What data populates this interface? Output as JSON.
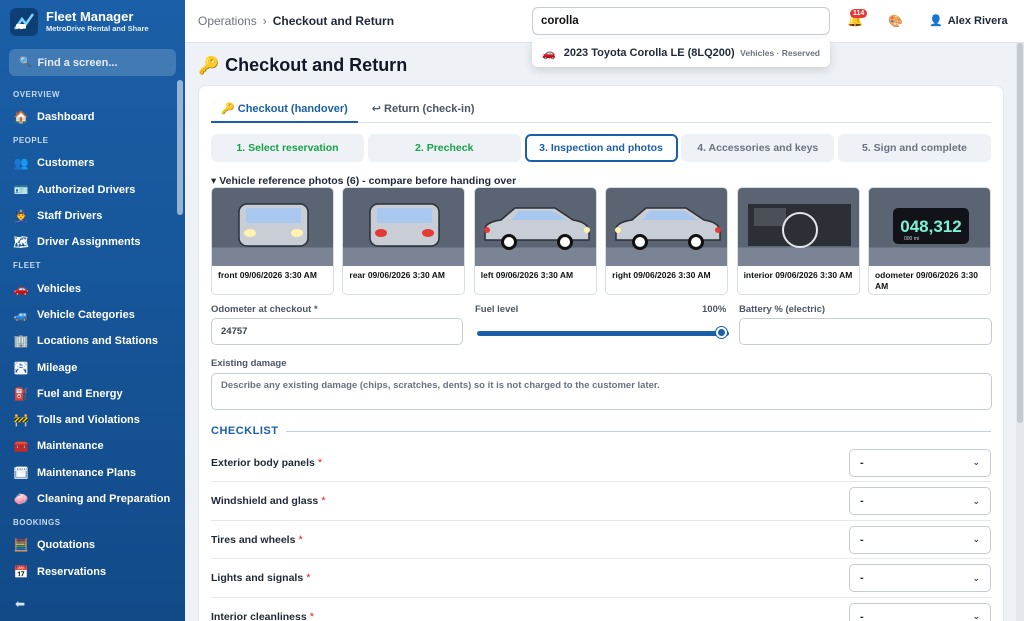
{
  "brand": {
    "title": "Fleet Manager",
    "subtitle": "MetroDrive Rental and Share"
  },
  "sidebar": {
    "find_placeholder": "Find a screen...",
    "sections": [
      {
        "label": "OVERVIEW",
        "items": [
          {
            "label": "Dashboard",
            "icon": "🏠"
          }
        ]
      },
      {
        "label": "PEOPLE",
        "items": [
          {
            "label": "Customers",
            "icon": "👥"
          },
          {
            "label": "Authorized Drivers",
            "icon": "🪪"
          },
          {
            "label": "Staff Drivers",
            "icon": "👮"
          },
          {
            "label": "Driver Assignments",
            "icon": "🗺"
          }
        ]
      },
      {
        "label": "FLEET",
        "items": [
          {
            "label": "Vehicles",
            "icon": "🚗"
          },
          {
            "label": "Vehicle Categories",
            "icon": "🚙"
          },
          {
            "label": "Locations and Stations",
            "icon": "🏢"
          },
          {
            "label": "Mileage",
            "icon": "🛣"
          },
          {
            "label": "Fuel and Energy",
            "icon": "⛽"
          },
          {
            "label": "Tolls and Violations",
            "icon": "🚧"
          },
          {
            "label": "Maintenance",
            "icon": "🧰"
          },
          {
            "label": "Maintenance Plans",
            "icon": "🗓"
          },
          {
            "label": "Cleaning and Preparation",
            "icon": "🧼"
          }
        ]
      },
      {
        "label": "BOOKINGS",
        "items": [
          {
            "label": "Quotations",
            "icon": "🧮"
          },
          {
            "label": "Reservations",
            "icon": "📅"
          }
        ]
      }
    ]
  },
  "topbar": {
    "breadcrumb_parent": "Operations",
    "breadcrumb_sep": "›",
    "breadcrumb_current": "Checkout and Return",
    "search_value": "corolla",
    "notification_count": "114",
    "user_name": "Alex Rivera"
  },
  "search_result": {
    "label": "2023 Toyota Corolla LE (8LQ200)",
    "meta": "Vehicles · Reserved"
  },
  "page": {
    "title": "Checkout and Return"
  },
  "tabs": [
    {
      "label": "🔑 Checkout (handover)",
      "active": true
    },
    {
      "label": "↩ Return (check-in)",
      "active": false
    }
  ],
  "steps": [
    {
      "label": "1. Select reservation",
      "state": "done"
    },
    {
      "label": "2. Precheck",
      "state": "done"
    },
    {
      "label": "3. Inspection and photos",
      "state": "active"
    },
    {
      "label": "4. Accessories and keys",
      "state": "todo"
    },
    {
      "label": "5. Sign and complete",
      "state": "todo"
    }
  ],
  "reference": {
    "title": "▾ Vehicle reference photos (6) - compare before handing over",
    "photos": [
      {
        "caption": "front 09/06/2026 3:30 AM",
        "kind": "front"
      },
      {
        "caption": "rear 09/06/2026 3:30 AM",
        "kind": "rear"
      },
      {
        "caption": "left 09/06/2026 3:30 AM",
        "kind": "left"
      },
      {
        "caption": "right 09/06/2026 3:30 AM",
        "kind": "right"
      },
      {
        "caption": "interior 09/06/2026 3:30 AM",
        "kind": "interior"
      },
      {
        "caption": "odometer 09/06/2026 3:30 AM",
        "kind": "odometer",
        "reading": "048,312",
        "unit": "000 mi"
      }
    ]
  },
  "form": {
    "odometer_label": "Odometer at checkout *",
    "odometer_value": "24757",
    "fuel_label": "Fuel level",
    "fuel_value": "100%",
    "fuel_fraction": 1.0,
    "battery_label": "Battery % (electric)",
    "battery_value": "",
    "damage_label": "Existing damage",
    "damage_placeholder": "Describe any existing damage (chips, scratches, dents) so it is not charged to the customer later."
  },
  "checklist": {
    "title": "CHECKLIST",
    "items": [
      {
        "label": "Exterior body panels",
        "value": "-"
      },
      {
        "label": "Windshield and glass",
        "value": "-"
      },
      {
        "label": "Tires and wheels",
        "value": "-"
      },
      {
        "label": "Lights and signals",
        "value": "-"
      },
      {
        "label": "Interior cleanliness",
        "value": "-"
      }
    ]
  },
  "colors": {
    "primary": "#1a5fa8",
    "done": "#16a34a",
    "required": "#dc2626"
  }
}
